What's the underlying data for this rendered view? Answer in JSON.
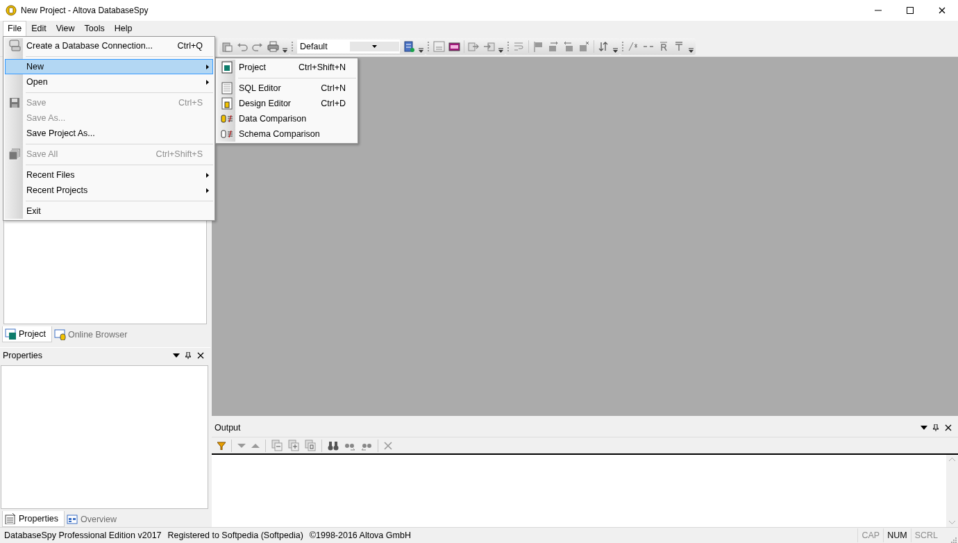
{
  "window": {
    "title": "New Project - Altova DatabaseSpy"
  },
  "menu_bar": [
    {
      "label": "File",
      "selected": true
    },
    {
      "label": "Edit",
      "selected": false
    },
    {
      "label": "View",
      "selected": false
    },
    {
      "label": "Tools",
      "selected": false
    },
    {
      "label": "Help",
      "selected": false
    }
  ],
  "toolbar": {
    "profile_combo": {
      "value": "Default"
    }
  },
  "file_menu": [
    {
      "kind": "item",
      "label": "Create a Database Connection...",
      "shortcut": "Ctrl+Q",
      "disabled": false,
      "submenu": false,
      "selected": false
    },
    {
      "kind": "separator"
    },
    {
      "kind": "item",
      "label": "New",
      "disabled": false,
      "submenu": true,
      "selected": true
    },
    {
      "kind": "item",
      "label": "Open",
      "disabled": false,
      "submenu": true,
      "selected": false
    },
    {
      "kind": "separator"
    },
    {
      "kind": "item",
      "label": "Save",
      "shortcut": "Ctrl+S",
      "disabled": true,
      "submenu": false,
      "selected": false
    },
    {
      "kind": "item",
      "label": "Save As...",
      "disabled": true,
      "submenu": false,
      "selected": false
    },
    {
      "kind": "item",
      "label": "Save Project As...",
      "disabled": false,
      "submenu": false,
      "selected": false
    },
    {
      "kind": "separator"
    },
    {
      "kind": "item",
      "label": "Save All",
      "shortcut": "Ctrl+Shift+S",
      "disabled": true,
      "submenu": false,
      "selected": false
    },
    {
      "kind": "separator"
    },
    {
      "kind": "item",
      "label": "Recent Files",
      "disabled": false,
      "submenu": true,
      "selected": false
    },
    {
      "kind": "item",
      "label": "Recent Projects",
      "disabled": false,
      "submenu": true,
      "selected": false
    },
    {
      "kind": "separator"
    },
    {
      "kind": "item",
      "label": "Exit",
      "disabled": false,
      "submenu": false,
      "selected": false
    }
  ],
  "new_submenu": [
    {
      "kind": "item",
      "label": "Project",
      "shortcut": "Ctrl+Shift+N",
      "disabled": false,
      "submenu": false,
      "selected": false
    },
    {
      "kind": "separator"
    },
    {
      "kind": "item",
      "label": "SQL Editor",
      "shortcut": "Ctrl+N",
      "disabled": false,
      "submenu": false,
      "selected": false
    },
    {
      "kind": "item",
      "label": "Design Editor",
      "shortcut": "Ctrl+D",
      "disabled": false,
      "submenu": false,
      "selected": false
    },
    {
      "kind": "item",
      "label": "Data Comparison",
      "disabled": false,
      "submenu": false,
      "selected": false
    },
    {
      "kind": "item",
      "label": "Schema Comparison",
      "disabled": false,
      "submenu": false,
      "selected": false
    }
  ],
  "project_panel": {
    "tabs": [
      {
        "label": "Project",
        "selected": true
      },
      {
        "label": "Online Browser",
        "selected": false
      }
    ]
  },
  "properties_panel": {
    "title": "Properties",
    "tabs": [
      {
        "label": "Properties",
        "selected": true
      },
      {
        "label": "Overview",
        "selected": false
      }
    ]
  },
  "output_panel": {
    "title": "Output"
  },
  "status_bar": {
    "texts": [
      "DatabaseSpy Professional Edition v2017",
      "Registered to Softpedia (Softpedia)",
      "©1998-2016 Altova GmbH"
    ],
    "indicators": [
      {
        "label": "CAP",
        "on": false
      },
      {
        "label": "NUM",
        "on": true
      },
      {
        "label": "SCRL",
        "on": false
      }
    ]
  }
}
